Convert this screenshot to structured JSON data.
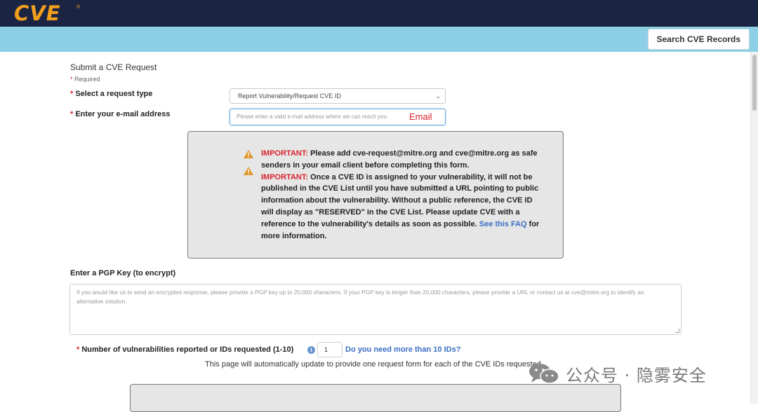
{
  "header": {
    "logo_text": "CVE",
    "logo_reg": "®",
    "search_button": "Search CVE Records"
  },
  "form": {
    "title": "Submit a CVE Request",
    "required_note": "Required",
    "request_type_label": "Select a request type",
    "request_type_value": "Report Vulnerability/Request CVE ID",
    "email_label": "Enter your e-mail address",
    "email_placeholder": "Please enter a valid e-mail address where we can reach you.",
    "email_annotation": "Email"
  },
  "notice": {
    "important_1": "IMPORTANT:",
    "text_1": "Please add cve-request@mitre.org and cve@mitre.org as safe senders in your email client before completing this form.",
    "important_2": "IMPORTANT:",
    "text_2": "Once a CVE ID is assigned to your vulnerability, it will not be published in the CVE List until you have submitted a URL pointing to public information about the vulnerability. Without a public reference, the CVE ID will display as \"RESERVED\" in the CVE List. Please update CVE with a reference to the vulnerability's details as soon as possible.",
    "faq_link": "See this FAQ",
    "text_3": "for more information."
  },
  "pgp": {
    "label": "Enter a PGP Key (to encrypt)",
    "placeholder": "If you would like us to send an encrypted response, please provide a PGP key up to 20,000 characters. If your PGP key is longer than 20,000 characters, please provide a URL or contact us at cve@mitre.org to identify an alternative solution."
  },
  "vulns": {
    "label": "Number of vulnerabilities reported or IDs requested (1-10)",
    "value": "1",
    "more_link": "Do you need more than 10 IDs?",
    "auto_text": "This page will automatically update to provide one request form for each of the CVE IDs requested."
  },
  "watermark": {
    "text": "公众号 · 隐雾安全"
  },
  "colors": {
    "topbar": "#1b2442",
    "subbar": "#8dd0e6",
    "logo": "#f2a01c",
    "important": "#d9232d",
    "link": "#3b6ec4"
  }
}
